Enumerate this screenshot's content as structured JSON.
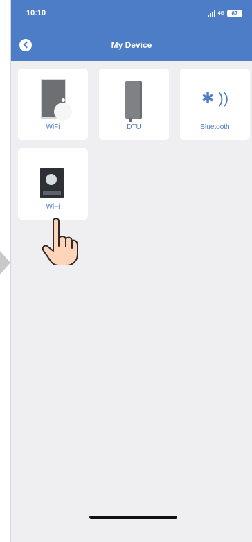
{
  "status_bar": {
    "time": "10:10",
    "battery": "67",
    "network": "4G"
  },
  "header": {
    "title": "My Device"
  },
  "devices": [
    {
      "label": "WiFi"
    },
    {
      "label": "DTU"
    },
    {
      "label": "Bluetooth"
    },
    {
      "label": "WiFi"
    }
  ],
  "colors": {
    "accent": "#4c7dc6",
    "background": "#efeef0"
  }
}
